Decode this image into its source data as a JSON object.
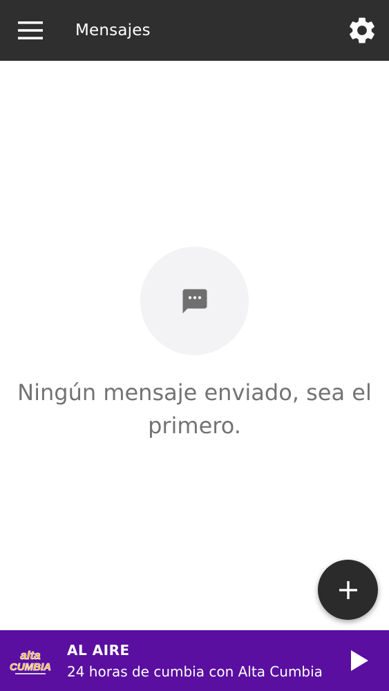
{
  "header": {
    "title": "Mensajes",
    "menu_icon": "hamburger-menu-icon",
    "settings_icon": "gear-icon",
    "background": "#2f2f2f"
  },
  "empty_state": {
    "icon": "chat-bubble-dots-icon",
    "message": "Ningún mensaje enviado, sea el primero."
  },
  "fab": {
    "icon": "plus-icon"
  },
  "player": {
    "logo_text_top": "alta",
    "logo_text_bottom": "CUMBIA",
    "status": "AL AIRE",
    "program": "24 horas de cumbia con Alta Cumbia",
    "play_icon": "play-icon",
    "background": "#5a0fa0",
    "logo_color": "#f5a300"
  }
}
